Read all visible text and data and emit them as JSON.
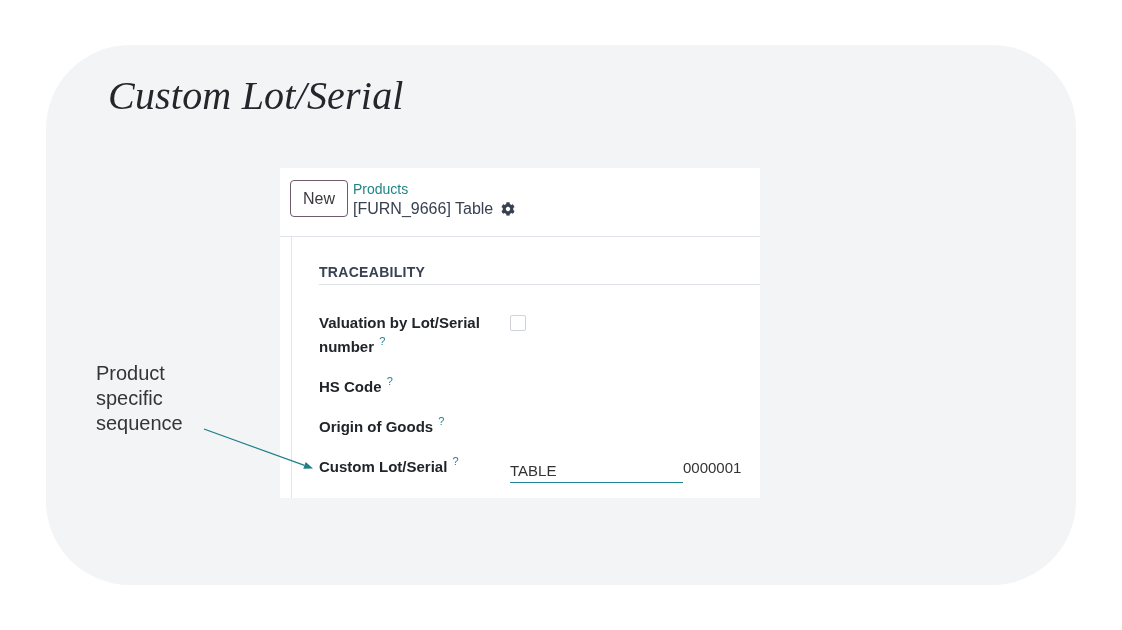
{
  "title": "Custom Lot/Serial",
  "annotation": {
    "text": "Product specific sequence"
  },
  "screen": {
    "new_button": "New",
    "breadcrumb": {
      "parent": "Products",
      "current": "[FURN_9666] Table"
    },
    "section": {
      "title": "TRACEABILITY",
      "fields": [
        {
          "kind": "checkbox",
          "label": "Valuation by Lot/Serial number $^{?}$",
          "checked": false
        },
        {
          "kind": "plain",
          "label": "HS Code $^{?}$"
        },
        {
          "kind": "plain",
          "label": "Origin of Goods $^{?}$"
        },
        {
          "kind": "sequence",
          "label": "Custom Lot/Serial $^{?}$",
          "value": "TABLE",
          "suffix": "0000001"
        }
      ]
    }
  }
}
